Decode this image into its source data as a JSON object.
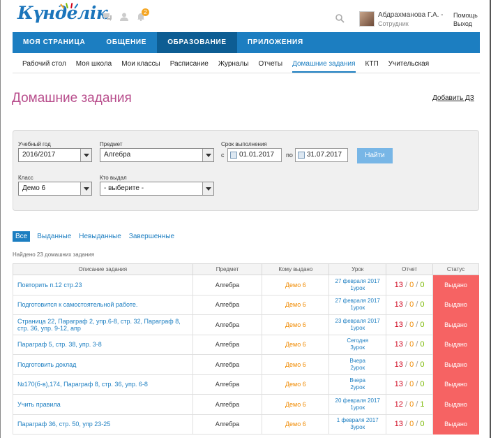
{
  "brand": {
    "logo_text": "Күнделік"
  },
  "header": {
    "notifications_count": "2",
    "user_name": "Абдрахманова Г.А. -",
    "user_role": "Сотрудник",
    "help_label": "Помощь",
    "exit_label": "Выход"
  },
  "nav": {
    "tabs": [
      {
        "label": "МОЯ СТРАНИЦА"
      },
      {
        "label": "ОБЩЕНИЕ"
      },
      {
        "label": "ОБРАЗОВАНИЕ"
      },
      {
        "label": "ПРИЛОЖЕНИЯ"
      }
    ],
    "sub": [
      {
        "label": "Рабочий стол"
      },
      {
        "label": "Моя школа"
      },
      {
        "label": "Мои классы"
      },
      {
        "label": "Расписание"
      },
      {
        "label": "Журналы"
      },
      {
        "label": "Отчеты"
      },
      {
        "label": "Домашние задания"
      },
      {
        "label": "КТП"
      },
      {
        "label": "Учительская"
      }
    ]
  },
  "page": {
    "title": "Домашние задания",
    "add_link": "Добавить ДЗ"
  },
  "filter": {
    "year_label": "Учебный год",
    "year_value": "2016/2017",
    "subject_label": "Предмет",
    "subject_value": "Алгебра",
    "deadline_label": "Срок выполнения",
    "from_prefix": "с",
    "date_from": "01.01.2017",
    "to_prefix": "по",
    "date_to": "31.07.2017",
    "find_label": "Найти",
    "class_label": "Класс",
    "class_value": "Демо 6",
    "issuer_label": "Кто выдал",
    "issuer_value": "- выберите -"
  },
  "status_tabs": [
    {
      "label": "Все"
    },
    {
      "label": "Выданные"
    },
    {
      "label": "Невыданные"
    },
    {
      "label": "Завершенные"
    }
  ],
  "found_text": "Найдено 23 домашних задания",
  "table": {
    "headers": [
      "Описание задания",
      "Предмет",
      "Кому выдано",
      "Урок",
      "Отчет",
      "Статус"
    ],
    "rows": [
      {
        "desc": "Повторить п.12 стр.23",
        "subject": "Алгебра",
        "to": "Демо 6",
        "lesson1": "27 февраля 2017",
        "lesson2": "1урок",
        "r1": "13",
        "r2": "0",
        "r3": "0",
        "status": "Выдано"
      },
      {
        "desc": "Подготовится к самостоятельной работе.",
        "subject": "Алгебра",
        "to": "Демо 6",
        "lesson1": "27 февраля 2017",
        "lesson2": "1урок",
        "r1": "13",
        "r2": "0",
        "r3": "0",
        "status": "Выдано"
      },
      {
        "desc": "Страница 22, Параграф 2, упр.6-8, стр. 32, Параграф 8, стр. 36, упр. 9-12, апр",
        "subject": "Алгебра",
        "to": "Демо 6",
        "lesson1": "23 февраля 2017",
        "lesson2": "1урок",
        "r1": "13",
        "r2": "0",
        "r3": "0",
        "status": "Выдано"
      },
      {
        "desc": "Параграф 5, стр. 38, упр. 3-8",
        "subject": "Алгебра",
        "to": "Демо 6",
        "lesson1": "Сегодня",
        "lesson2": "3урок",
        "r1": "13",
        "r2": "0",
        "r3": "0",
        "status": "Выдано"
      },
      {
        "desc": "Подготовить доклад",
        "subject": "Алгебра",
        "to": "Демо 6",
        "lesson1": "Вчера",
        "lesson2": "2урок",
        "r1": "13",
        "r2": "0",
        "r3": "0",
        "status": "Выдано"
      },
      {
        "desc": "№170(б-в),174, Параграф 8, стр. 36, упр. 6-8",
        "subject": "Алгебра",
        "to": "Демо 6",
        "lesson1": "Вчера",
        "lesson2": "2урок",
        "r1": "13",
        "r2": "0",
        "r3": "0",
        "status": "Выдано"
      },
      {
        "desc": "Учить правила",
        "subject": "Алгебра",
        "to": "Демо 6",
        "lesson1": "20 февраля 2017",
        "lesson2": "1урок",
        "r1": "12",
        "r2": "0",
        "r3": "1",
        "status": "Выдано"
      },
      {
        "desc": "Параграф 36, стр. 50, упр 23-25",
        "subject": "Алгебра",
        "to": "Демо 6",
        "lesson1": "1 февраля 2017",
        "lesson2": "3урок",
        "r1": "13",
        "r2": "0",
        "r3": "0",
        "status": "Выдано"
      }
    ]
  },
  "colors": {
    "brand_blue": "#1c7ec1",
    "nav_active": "#0d5d93",
    "title_pink": "#b84d8c",
    "status_red": "#f66363",
    "issued_orange": "#f08a00",
    "report_green": "#7ab800"
  },
  "icons": [
    "chat-icon",
    "user-icon",
    "bell-icon",
    "search-icon",
    "calendar-icon"
  ]
}
